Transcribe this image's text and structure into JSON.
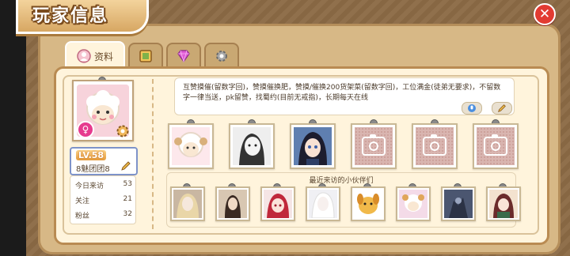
{
  "window": {
    "title": "玩家信息",
    "close_label": "✕"
  },
  "tabs": [
    {
      "label": "资料",
      "icon": "profile-icon",
      "active": true
    },
    {
      "label": "",
      "icon": "album-icon",
      "active": false
    },
    {
      "label": "",
      "icon": "diamond-icon",
      "active": false
    },
    {
      "label": "",
      "icon": "settings-icon",
      "active": false
    }
  ],
  "profile": {
    "gender_symbol": "♀",
    "level": "LV.58",
    "guild": "8魅团团8",
    "stats": [
      {
        "label": "今日来访",
        "value": "53"
      },
      {
        "label": "关注",
        "value": "21"
      },
      {
        "label": "粉丝",
        "value": "32"
      }
    ]
  },
  "bio": {
    "text": "互赞摸催(留数字回)，赞摸催换肥，赞摸/催换200货架菜(留数字回)，工位满金(徒弟无要求)，不留数字一律当送，pk留赞，找蜀约(目前无戒指)，长期每天在线"
  },
  "photos": [
    {
      "kind": "sheep",
      "icon": "sheep-photo"
    },
    {
      "kind": "anime-bw",
      "icon": "anime-girl-photo"
    },
    {
      "kind": "anime-color",
      "icon": "anime-girl-photo"
    },
    {
      "kind": "empty",
      "icon": "camera-icon"
    },
    {
      "kind": "empty",
      "icon": "camera-icon"
    },
    {
      "kind": "empty",
      "icon": "camera-icon"
    }
  ],
  "visitors": {
    "title": "最近来访的小伙伴们",
    "items": [
      {
        "icon": "visitor-avatar"
      },
      {
        "icon": "visitor-avatar"
      },
      {
        "icon": "visitor-avatar"
      },
      {
        "icon": "visitor-avatar"
      },
      {
        "icon": "visitor-avatar"
      },
      {
        "icon": "visitor-avatar"
      },
      {
        "icon": "visitor-avatar"
      },
      {
        "icon": "visitor-avatar"
      }
    ]
  },
  "colors": {
    "accent": "#e23b32",
    "panel": "#fff4dc",
    "frame": "#8b6a45",
    "level_border": "#7e93c9"
  }
}
